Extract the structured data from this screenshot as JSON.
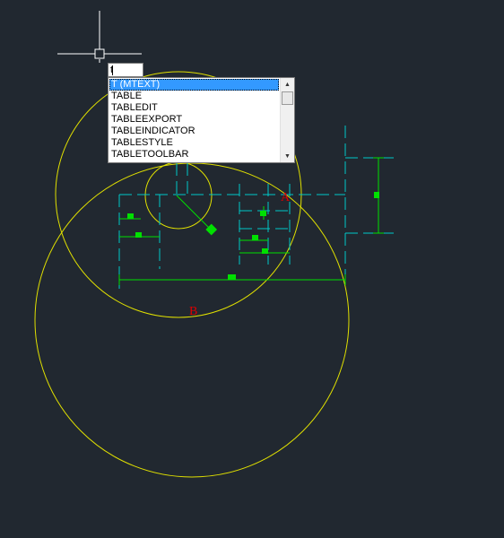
{
  "command_line": {
    "typed_value": "t"
  },
  "autocomplete": {
    "items": [
      "T (MTEXT)",
      "TABLE",
      "TABLEDIT",
      "TABLEEXPORT",
      "TABLEINDICATOR",
      "TABLESTYLE",
      "TABLETOOLBAR"
    ],
    "selected_index": 0
  },
  "drawing": {
    "labels": {
      "point_a": "A",
      "point_b": "B"
    }
  },
  "colors": {
    "background": "#212830",
    "circle": "#e0e000",
    "dimension_line": "#00c8c8",
    "grip": "#00e000",
    "label": "#e00000",
    "crosshair": "#ffffff",
    "selection_highlight": "#3399ff"
  },
  "icons": {
    "cursor": "crosshair-pickbox-icon",
    "scroll_up": "triangle-up-icon",
    "scroll_down": "triangle-down-icon"
  }
}
